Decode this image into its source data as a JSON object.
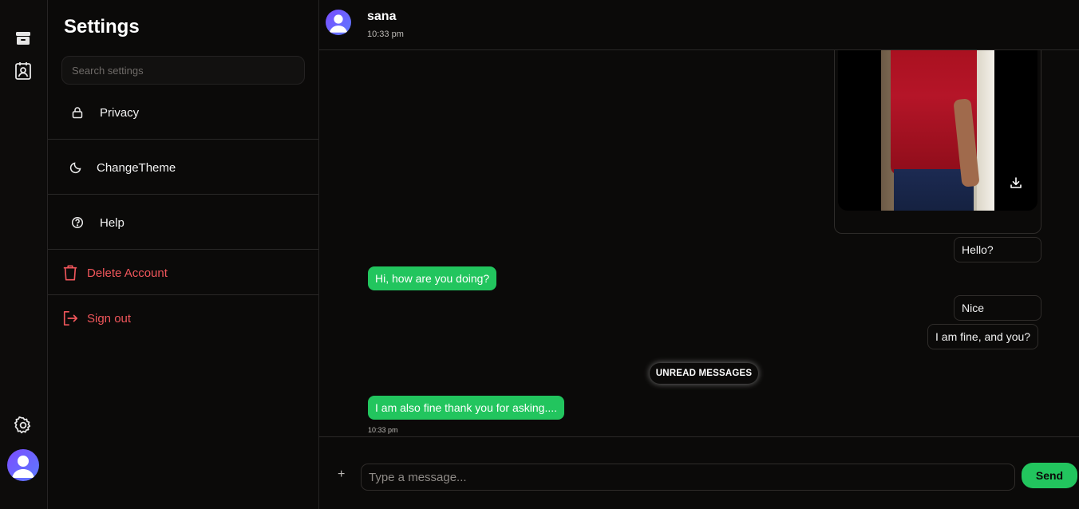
{
  "rail": {
    "items": [
      {
        "icon": "archive-icon"
      },
      {
        "icon": "contacts-icon"
      }
    ],
    "settings_icon": "gear-icon",
    "avatar_icon": "user-avatar-icon"
  },
  "settings": {
    "title": "Settings",
    "search_placeholder": "Search settings",
    "items": [
      {
        "label": "Privacy",
        "icon": "lock-icon"
      },
      {
        "label": "ChangeTheme",
        "icon": "moon-icon"
      },
      {
        "label": "Help",
        "icon": "help-circle-icon"
      },
      {
        "label": "Delete Account",
        "icon": "trash-icon",
        "color": "#f0565b"
      },
      {
        "label": "Sign out",
        "icon": "sign-out-icon",
        "color": "#f0565b"
      }
    ]
  },
  "chat": {
    "contact_name": "sana",
    "last_seen": "10:33 pm",
    "messages": [
      {
        "type": "image",
        "direction": "out",
        "icon": "download-icon"
      },
      {
        "direction": "out",
        "text": "Hello?"
      },
      {
        "direction": "in",
        "text": "Hi, how are you doing?"
      },
      {
        "direction": "out",
        "text": "Nice"
      },
      {
        "direction": "out",
        "text": "I am fine, and you?"
      },
      {
        "direction": "in",
        "text": "I am also fine thank you for asking....",
        "time": "10:33 pm"
      }
    ],
    "unread_label": "UNREAD MESSAGES",
    "composer": {
      "plus_label": "+",
      "placeholder": "Type a message...",
      "send_label": "Send"
    }
  },
  "colors": {
    "accent_green": "#22c55e",
    "danger_red": "#f0565b",
    "background": "#0b0a09",
    "avatar_purple": "#7a4cff"
  }
}
